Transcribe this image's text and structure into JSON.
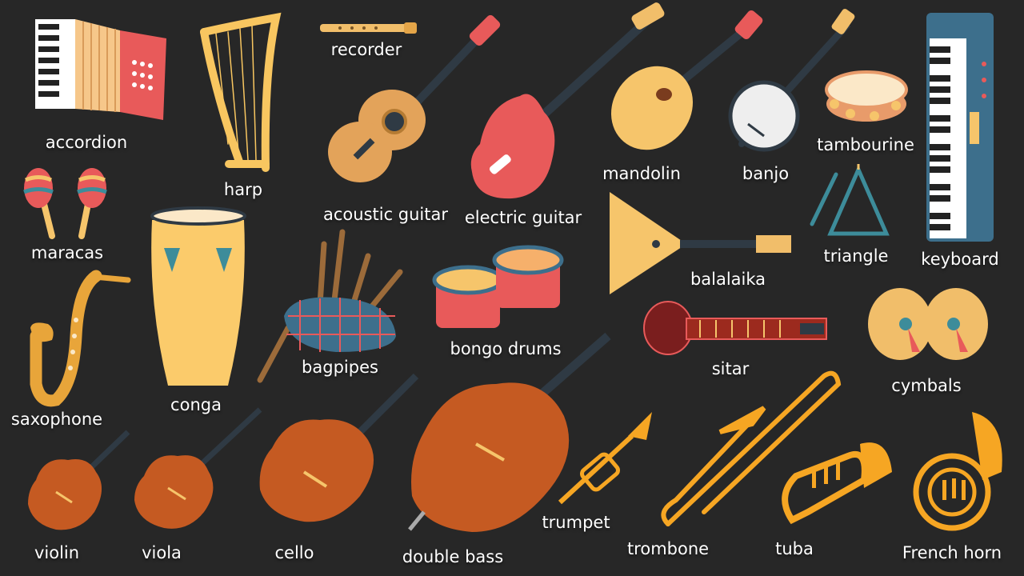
{
  "background_color": "#272727",
  "label_color": "#ffffff",
  "instruments": [
    {
      "id": "accordion",
      "label": "accordion"
    },
    {
      "id": "harp",
      "label": "harp"
    },
    {
      "id": "recorder",
      "label": "recorder"
    },
    {
      "id": "acoustic-guitar",
      "label": "acoustic guitar"
    },
    {
      "id": "electric-guitar",
      "label": "electric guitar"
    },
    {
      "id": "mandolin",
      "label": "mandolin"
    },
    {
      "id": "banjo",
      "label": "banjo"
    },
    {
      "id": "tambourine",
      "label": "tambourine"
    },
    {
      "id": "keyboard",
      "label": "keyboard"
    },
    {
      "id": "maracas",
      "label": "maracas"
    },
    {
      "id": "conga",
      "label": "conga"
    },
    {
      "id": "bagpipes",
      "label": "bagpipes"
    },
    {
      "id": "bongo-drums",
      "label": "bongo drums"
    },
    {
      "id": "balalaika",
      "label": "balalaika"
    },
    {
      "id": "triangle",
      "label": "triangle"
    },
    {
      "id": "sitar",
      "label": "sitar"
    },
    {
      "id": "cymbals",
      "label": "cymbals"
    },
    {
      "id": "saxophone",
      "label": "saxophone"
    },
    {
      "id": "violin",
      "label": "violin"
    },
    {
      "id": "viola",
      "label": "viola"
    },
    {
      "id": "cello",
      "label": "cello"
    },
    {
      "id": "double-bass",
      "label": "double bass"
    },
    {
      "id": "trumpet",
      "label": "trumpet"
    },
    {
      "id": "trombone",
      "label": "trombone"
    },
    {
      "id": "tuba",
      "label": "tuba"
    },
    {
      "id": "french-horn",
      "label": "French horn"
    }
  ]
}
